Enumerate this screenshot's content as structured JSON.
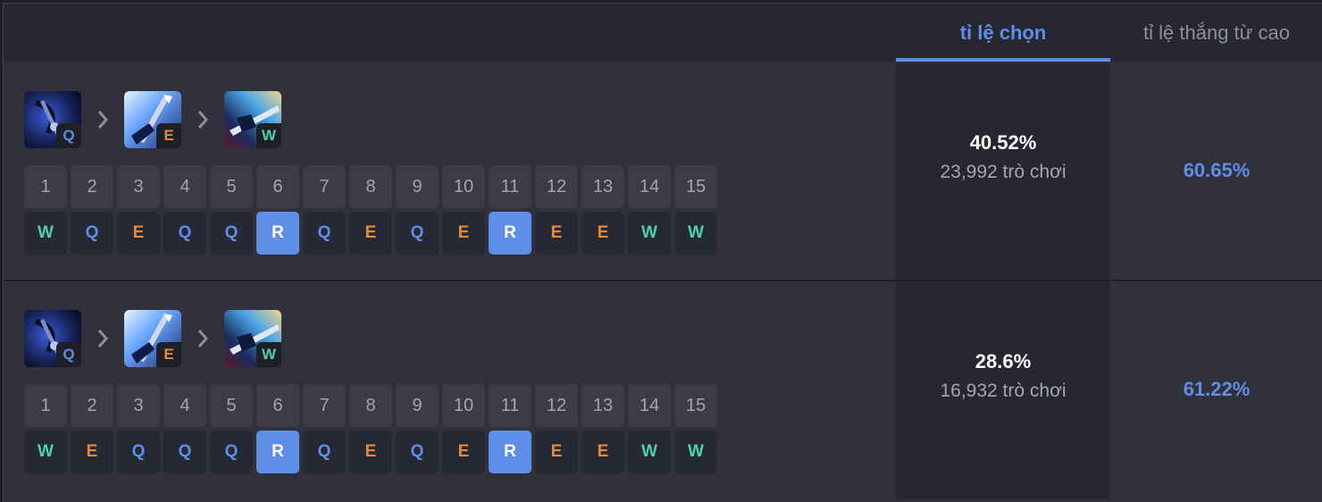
{
  "colors": {
    "accent": "#5f8ee8",
    "q": "#5f8ee8",
    "w": "#4fd1a8",
    "e": "#e58a3c",
    "r_text": "#ffffff"
  },
  "tabs": {
    "pick_rate": "tỉ lệ chọn",
    "win_rate": "tỉ lệ thắng từ cao"
  },
  "levels": [
    "1",
    "2",
    "3",
    "4",
    "5",
    "6",
    "7",
    "8",
    "9",
    "10",
    "11",
    "12",
    "13",
    "14",
    "15"
  ],
  "builds": [
    {
      "order": [
        {
          "key": "Q",
          "icon": "q-skill-icon"
        },
        {
          "key": "E",
          "icon": "e-skill-icon"
        },
        {
          "key": "W",
          "icon": "w-skill-icon"
        }
      ],
      "sequence": [
        "W",
        "Q",
        "E",
        "Q",
        "Q",
        "R",
        "Q",
        "E",
        "Q",
        "E",
        "R",
        "E",
        "E",
        "W",
        "W"
      ],
      "pick_rate": "40.52%",
      "games": "23,992 trò chơi",
      "win_rate": "60.65%"
    },
    {
      "order": [
        {
          "key": "Q",
          "icon": "q-skill-icon"
        },
        {
          "key": "E",
          "icon": "e-skill-icon"
        },
        {
          "key": "W",
          "icon": "w-skill-icon"
        }
      ],
      "sequence": [
        "W",
        "E",
        "Q",
        "Q",
        "Q",
        "R",
        "Q",
        "E",
        "Q",
        "E",
        "R",
        "E",
        "E",
        "W",
        "W"
      ],
      "pick_rate": "28.6%",
      "games": "16,932 trò chơi",
      "win_rate": "61.22%"
    }
  ]
}
